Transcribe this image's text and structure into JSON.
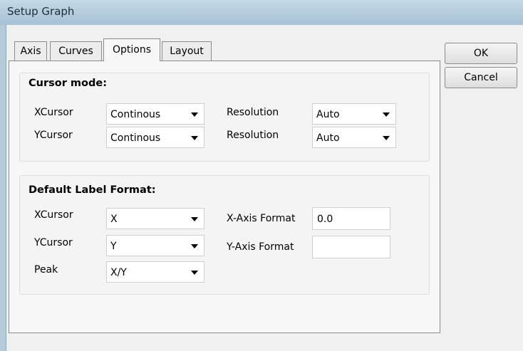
{
  "window": {
    "title": "Setup Graph"
  },
  "tabs": [
    {
      "label": "Axis",
      "active": false
    },
    {
      "label": "Curves",
      "active": false
    },
    {
      "label": "Options",
      "active": true
    },
    {
      "label": "Layout",
      "active": false
    }
  ],
  "buttons": {
    "ok": "OK",
    "cancel": "Cancel"
  },
  "cursor_mode": {
    "title": "Cursor mode:",
    "rows": [
      {
        "label": "XCursor",
        "value": "Continous",
        "res_label": "Resolution",
        "res_value": "Auto"
      },
      {
        "label": "YCursor",
        "value": "Continous",
        "res_label": "Resolution",
        "res_value": "Auto"
      }
    ]
  },
  "label_format": {
    "title": "Default Label Format:",
    "rows": [
      {
        "label": "XCursor",
        "value": "X"
      },
      {
        "label": "YCursor",
        "value": "Y"
      },
      {
        "label": "Peak",
        "value": "X/Y"
      }
    ],
    "x_axis_format": {
      "label": "X-Axis Format",
      "value": "0.0"
    },
    "y_axis_format": {
      "label": "Y-Axis Format",
      "value": ""
    }
  },
  "icons": {
    "dropdown": "chevron-down-icon"
  }
}
